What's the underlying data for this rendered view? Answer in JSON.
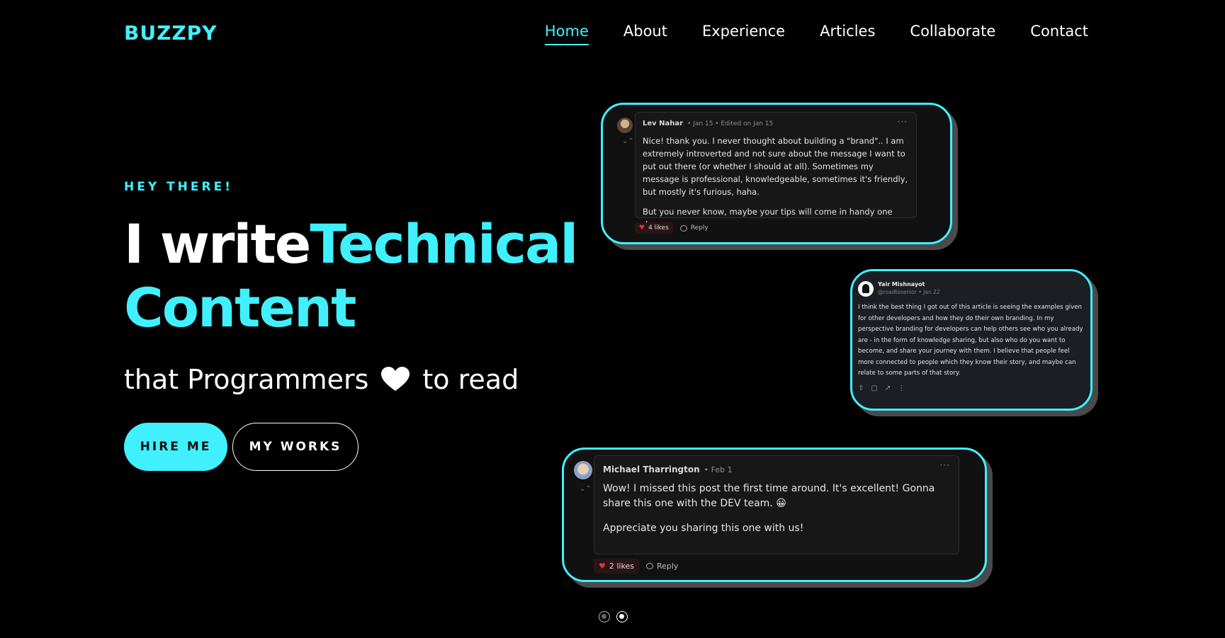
{
  "brand": {
    "logo": "BUZZPY",
    "accent": "#41f0ff"
  },
  "nav": {
    "items": [
      {
        "label": "Home",
        "active": true
      },
      {
        "label": "About"
      },
      {
        "label": "Experience"
      },
      {
        "label": "Articles"
      },
      {
        "label": "Collaborate"
      },
      {
        "label": "Contact"
      }
    ]
  },
  "hero": {
    "kicker": "HEY THERE!",
    "headline_white": "I write",
    "headline_cyan_1": "Technical",
    "headline_cyan_2": "Content",
    "sub_before": "that Programmers",
    "sub_icon": "heart-icon",
    "sub_after": "to read",
    "hire_label": "HIRE ME",
    "works_label": "MY WORKS"
  },
  "testimonials": [
    {
      "author": "Lev Nahar",
      "date": "Jan 15 • Edited on Jan 15",
      "paragraphs": [
        "Nice! thank you. I never thought about building a \"brand\".. I am extremely introverted and not sure about the message I want to put out there (or whether I should at all). Sometimes my message is professional, knowledgeable, sometimes it's friendly, but mostly it's furious, haha.",
        "But you never know, maybe your tips will come in handy one day."
      ],
      "likes": "4 likes",
      "reply": "Reply"
    },
    {
      "author": "Yair Mishnayot",
      "handle": "@roadtosenior",
      "date": "Jan 22",
      "paragraphs": [
        "I think the best thing I got out of this article is seeing the examples given for other developers and how they do their own branding. In my perspective branding for developers can help others see who you already are - in the form of knowledge sharing, but also who do you want to become, and share your journey with them. I believe that people feel more connected to people which they know their story, and maybe can relate to some parts of that story."
      ]
    },
    {
      "author": "Michael Tharrington",
      "date": "Feb 1",
      "paragraphs": [
        "Wow! I missed this post the first time around. It's excellent! Gonna share this one with the DEV team. 😀",
        "Appreciate you sharing this one with us!"
      ],
      "likes": "2 likes",
      "reply": "Reply"
    }
  ],
  "carousel": {
    "total": 2,
    "active": 2
  }
}
